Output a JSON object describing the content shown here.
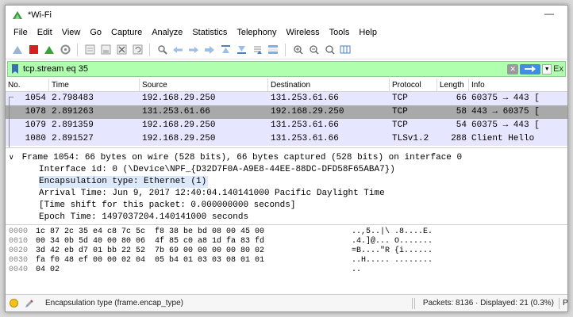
{
  "window": {
    "title": "*Wi-Fi",
    "minimize_label": "—"
  },
  "menu": [
    "File",
    "Edit",
    "View",
    "Go",
    "Capture",
    "Analyze",
    "Statistics",
    "Telephony",
    "Wireless",
    "Tools",
    "Help"
  ],
  "toolbar": {
    "icons": [
      "shark-fin-start-icon",
      "stop-capture-icon",
      "restart-capture-icon",
      "capture-options-icon",
      "open-file-icon",
      "save-file-icon",
      "close-file-icon",
      "reload-file-icon",
      "find-packet-icon",
      "go-back-icon",
      "go-forward-icon",
      "go-to-packet-icon",
      "go-first-icon",
      "go-last-icon",
      "autoscroll-icon",
      "colorize-icon",
      "zoom-in-icon",
      "zoom-out-icon",
      "zoom-normal-icon",
      "resize-columns-icon"
    ]
  },
  "filter": {
    "value": "tcp.stream eq 35",
    "expression_label": "Ex"
  },
  "columns": [
    "No.",
    "Time",
    "Source",
    "Destination",
    "Protocol",
    "Length",
    "Info"
  ],
  "packets": [
    {
      "no": "1054",
      "time": "2.798483",
      "source": "192.168.29.250",
      "destination": "131.253.61.66",
      "protocol": "TCP",
      "length": "66",
      "info": "60375 → 443 ["
    },
    {
      "no": "1078",
      "time": "2.891263",
      "source": "131.253.61.66",
      "destination": "192.168.29.250",
      "protocol": "TCP",
      "length": "58",
      "info": "443 → 60375 ["
    },
    {
      "no": "1079",
      "time": "2.891359",
      "source": "192.168.29.250",
      "destination": "131.253.61.66",
      "protocol": "TCP",
      "length": "54",
      "info": "60375 → 443 ["
    },
    {
      "no": "1080",
      "time": "2.891527",
      "source": "192.168.29.250",
      "destination": "131.253.61.66",
      "protocol": "TLSv1.2",
      "length": "288",
      "info": "Client Hello"
    }
  ],
  "details": {
    "frame_summary": "Frame 1054: 66 bytes on wire (528 bits), 66 bytes captured (528 bits) on interface 0",
    "lines": [
      "Interface id: 0 (\\Device\\NPF_{D32D7F0A-A9E8-44EE-88DC-DFD58F65ABA7})",
      "Encapsulation type: Ethernet (1)",
      "Arrival Time: Jun  9, 2017 12:40:04.140141000 Pacific Daylight Time",
      "[Time shift for this packet: 0.000000000 seconds]",
      "Epoch Time: 1497037204.140141000 seconds"
    ]
  },
  "bytes": [
    {
      "offset": "0000",
      "hex": "1c 87 2c 35 e4 c8 7c 5c  f8 38 be bd 08 00 45 00",
      "ascii": "..,5..|\\ .8....E."
    },
    {
      "offset": "0010",
      "hex": "00 34 0b 5d 40 00 80 06  4f 85 c0 a8 1d fa 83 fd",
      "ascii": ".4.]@... O......."
    },
    {
      "offset": "0020",
      "hex": "3d 42 eb d7 01 bb 22 52  7b 69 00 00 00 00 80 02",
      "ascii": "=B....\"R {i......"
    },
    {
      "offset": "0030",
      "hex": "fa f0 48 ef 00 00 02 04  05 b4 01 03 03 08 01 01",
      "ascii": "..H..... ........"
    },
    {
      "offset": "0040",
      "hex": "04 02",
      "ascii": ".."
    }
  ],
  "status": {
    "field_text": "Encapsulation type (frame.encap_type)",
    "packets_text": "Packets: 8136 · Displayed: 21 (0.3%)",
    "profile_text": "P"
  },
  "colors": {
    "filter_ok": "#afffaf",
    "tcp_row": "#e7e6ff",
    "selected_row": "#a9a9a9",
    "field_highlight": "#dce9fb",
    "expert_led": "#f3c21a"
  }
}
